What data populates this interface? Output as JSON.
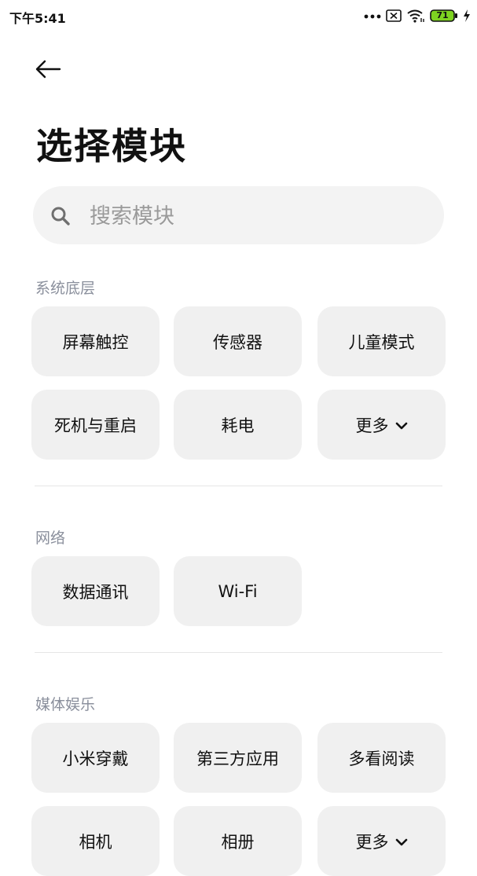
{
  "status_bar": {
    "time": "下午5:41",
    "battery": "71"
  },
  "title": "选择模块",
  "search": {
    "placeholder": "搜索模块"
  },
  "sections": [
    {
      "label": "系统底层",
      "chips": [
        "屏幕触控",
        "传感器",
        "儿童模式",
        "死机与重启",
        "耗电",
        "更多"
      ]
    },
    {
      "label": "网络",
      "chips": [
        "数据通讯",
        "Wi-Fi"
      ]
    },
    {
      "label": "媒体娱乐",
      "chips": [
        "小米穿戴",
        "第三方应用",
        "多看阅读",
        "相机",
        "相册",
        "更多"
      ]
    }
  ],
  "icons": {
    "back": "arrow-left-icon",
    "search": "search-icon",
    "more": "chevron-down-icon",
    "overflow": "more-dots-icon",
    "sim": "no-sim-icon",
    "wifi": "wifi-icon",
    "battery": "battery-icon",
    "charging": "charging-icon"
  },
  "colors": {
    "chip_bg": "#f0f0f0",
    "search_bg": "#f3f3f3",
    "section_label": "#8a8f9c",
    "battery_fill": "#7ed321"
  }
}
